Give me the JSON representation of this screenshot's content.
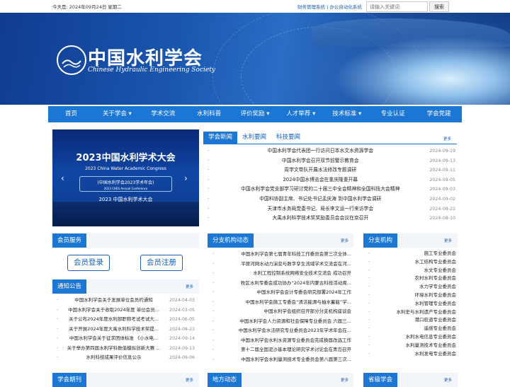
{
  "topbar": {
    "date": "今天是: 2024年09月24日 星期二",
    "links": [
      "财务管理系统",
      "办公自动化系统"
    ],
    "search_placeholder": "请输入关键词",
    "search_button": "搜索"
  },
  "banner": {
    "logo_cn": "中国水利学会",
    "logo_en": "Chinese Hydraulic Engineering Society",
    "logo_mark": "中国水利学会"
  },
  "nav": [
    "首页",
    "关于学会 ▾",
    "学术交流",
    "水利科普",
    "评价奖励 ▾",
    "人才举荐 ▾",
    "技术标准 ▾",
    "专业认证",
    "学会党建"
  ],
  "slider": {
    "title": "2023中国水利学术大会",
    "title_en": "2023 China Water Academic Congress",
    "box_title": "(中国水利学会2023学术年会)",
    "box_sub": "2023 CHES Annual Conference",
    "lower": "2023 中国水利学术大会",
    "prev": "‹",
    "next": "›"
  },
  "news_tabs": [
    "学会新闻",
    "水利要闻",
    "科技要闻"
  ],
  "more": "更多",
  "news": [
    {
      "title": "中国水利学会代表团一行访问日本水文水资源学会",
      "date": "2024-09-19"
    },
    {
      "title": "中国水利学会召开双节前警示教育会",
      "date": "2024-09-13"
    },
    {
      "title": "周学文带队开展水法修改专题调研",
      "date": "2024-09-11"
    },
    {
      "title": "2024中国水博览会在重庆隆重开幕",
      "date": "2024-09-05"
    },
    {
      "title": "中国水利学会党支部学习研讨党的二十届三中全会精神和全国科技大会精神",
      "date": "2024-09-03"
    },
    {
      "title": "中国科协副主席、书记处书记孟庆海 到中国水利学会调研",
      "date": "2024-09-02"
    },
    {
      "title": "天津市水务局党委书记、局长李文运一行来访学会",
      "date": "2024-08-22"
    },
    {
      "title": "大禹水利科学技术奖奖励委员会会议在京召开",
      "date": "2024-08-10"
    }
  ],
  "member": {
    "title": "会员服务",
    "login": "会员登录",
    "register": "会员注册"
  },
  "notice": {
    "title": "通知公告",
    "items": [
      {
        "title": "中国水利学会关于发展单位会员的通知",
        "date": "2024-04-03"
      },
      {
        "title": "中国水利学会关于收取2024年度 单位会员...",
        "date": "2024-03-05"
      },
      {
        "title": "关于公布2024年度水利部职称考试考试大...",
        "date": "2024-06-05"
      },
      {
        "title": "关于开展2024年度大禹水利科学技术奖提...",
        "date": "2024-08-23"
      },
      {
        "title": "中国水利学会关于征求团体标准 《小水电...",
        "date": "2024-09-14"
      },
      {
        "title": "关于举办第四届水利学科数值模拟创新大赛 ...",
        "date": "2024-09-13"
      },
      {
        "title": "水利科技成果评价信息公示",
        "date": "2024-09-06"
      }
    ]
  },
  "branch_news": {
    "title": "分支机构动态",
    "items": [
      "中国水利学会第七届青年科技工作委员会第三次全体...",
      "平原河网水动力演变与数字孪生流域学术交流会在河...",
      "水利工程控制系统网络安全技术交流会 成功召开",
      "牧区水利专委会成功协办“2024年内蒙古科技活动周...",
      "中国水利学会会计专委会研究部署2024年工作",
      "中国水利学会施工专委会“清洁能源与抽水蓄能”学...",
      "中国水利学会组织召开部分分支机构座谈会",
      "中国水利学会人力资源和社会保障专业委员会 六届三...",
      "中国水利学会水法研究专业委员会2023年学术年会在...",
      "中国水利学会水利水资源专业委员会完成换届改选工作",
      "第十二届全国泥沙基本理论研究学术讨论会在青岛召开",
      "中国水利学会水利量测技术专业委员会第八届第三次..."
    ]
  },
  "branches": {
    "title": "分支机构",
    "items": [
      "施工专业委员会",
      "水工结构专业委员会",
      "水文专业委员会",
      "农村水利专业委员会",
      "水力学专业委员会",
      "环境水利专业委员会",
      "水利管理专业委员会",
      "水利史与水利遗产专业委员会",
      "港口航道专业委员会",
      "遥感专业委员会",
      "水利水电信息专业委员会",
      "水利量测技术专业委员会",
      "水利发电专业委员会"
    ]
  },
  "bottom": {
    "journal": "学会期刊",
    "local": "地方动态",
    "provincial": "省级学会"
  }
}
